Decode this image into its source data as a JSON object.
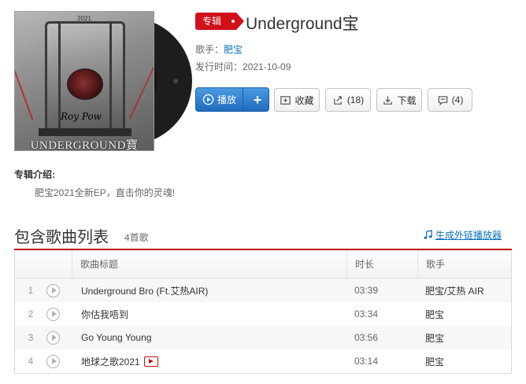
{
  "album": {
    "badge": "专辑",
    "title": "Underground宝",
    "artist_label": "歌手：",
    "artist": "肥宝",
    "release_label": "发行时间：",
    "release_date": "2021-10-09",
    "cover": {
      "year_text": "2021",
      "script_text": "Roy Pow",
      "title_text": "UNDERGROUND寶"
    }
  },
  "actions": {
    "play": "播放",
    "add": "+",
    "collect": "收藏",
    "share": "(18)",
    "download": "下载",
    "comment": "(4)"
  },
  "intro": {
    "title": "专辑介绍:",
    "text": "肥宝2021全新EP，直击你的灵魂!"
  },
  "song_list": {
    "title": "包含歌曲列表",
    "count": "4首歌",
    "external_link": "生成外链播放器",
    "headers": {
      "title": "歌曲标题",
      "duration": "时长",
      "artist": "歌手"
    },
    "rows": [
      {
        "num": "1",
        "title": "Underground Bro (Ft.艾热AIR)",
        "duration": "03:39",
        "artist": "肥宝/艾热 AIR",
        "has_mv": false
      },
      {
        "num": "2",
        "title": "你估我唔到",
        "duration": "03:34",
        "artist": "肥宝",
        "has_mv": false
      },
      {
        "num": "3",
        "title": "Go Young Young",
        "duration": "03:56",
        "artist": "肥宝",
        "has_mv": false
      },
      {
        "num": "4",
        "title": "地球之歌2021",
        "duration": "03:14",
        "artist": "肥宝",
        "has_mv": true
      }
    ]
  },
  "colors": {
    "accent_red": "#c20c0c",
    "link_blue": "#0c73c2",
    "play_blue": "#1e6bbd"
  },
  "icons": {
    "play": "play-circle-icon",
    "collect": "folder-plus-icon",
    "share": "share-icon",
    "download": "download-icon",
    "comment": "comment-icon",
    "external": "music-note-icon",
    "mv": "mv-icon"
  }
}
